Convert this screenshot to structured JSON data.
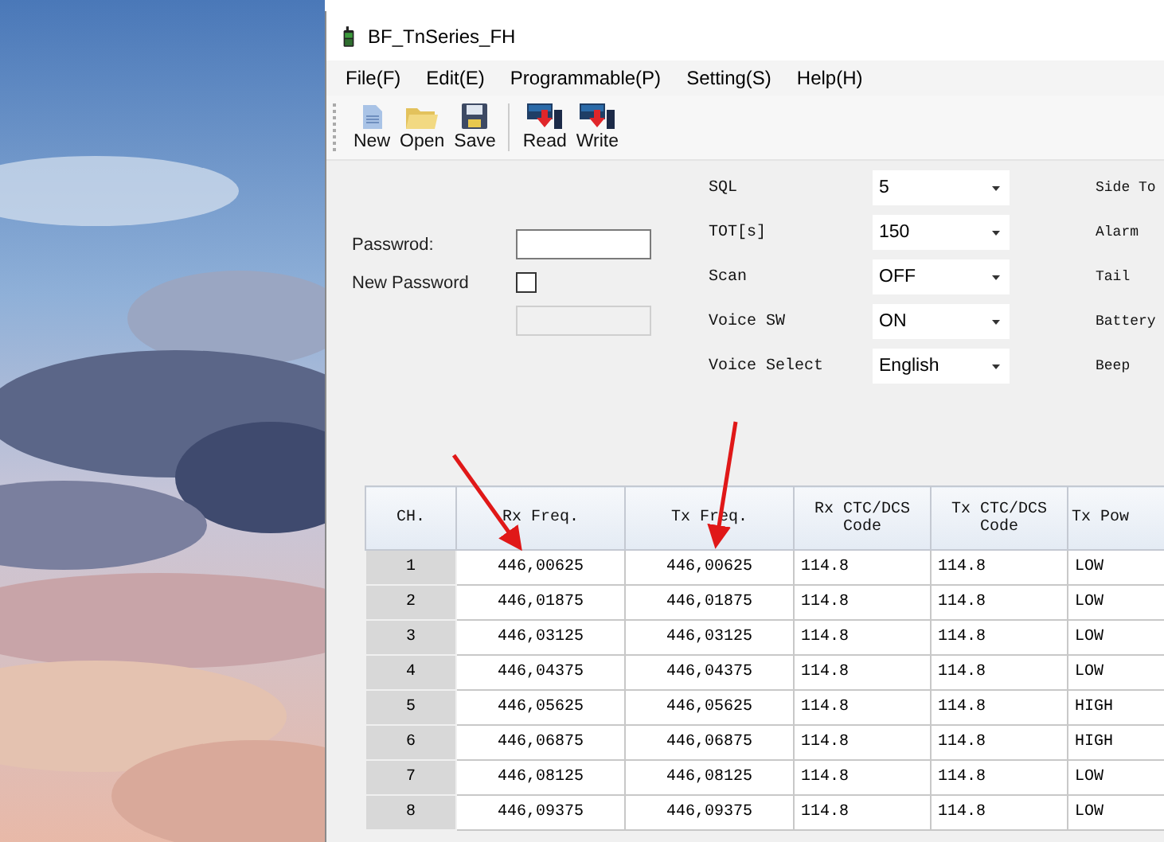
{
  "window": {
    "title": "BF_TnSeries_FH"
  },
  "menu": [
    "File(F)",
    "Edit(E)",
    "Programmable(P)",
    "Setting(S)",
    "Help(H)"
  ],
  "toolbar": [
    {
      "label": "New",
      "kind": "new"
    },
    {
      "label": "Open",
      "kind": "open"
    },
    {
      "label": "Save",
      "kind": "save"
    },
    {
      "label": "Read",
      "kind": "read"
    },
    {
      "label": "Write",
      "kind": "write"
    }
  ],
  "password": {
    "label": "Passwrod:"
  },
  "new_password": {
    "label": "New Password",
    "checked": false
  },
  "settings": [
    {
      "label": "SQL",
      "value": "5",
      "side_label": "Side To"
    },
    {
      "label": "TOT[s]",
      "value": "150",
      "side_label": "Alarm"
    },
    {
      "label": "Scan",
      "value": "OFF",
      "side_label": "Tail"
    },
    {
      "label": "Voice SW",
      "value": "ON",
      "side_label": "Battery"
    },
    {
      "label": "Voice Select",
      "value": "English",
      "side_label": "Beep"
    }
  ],
  "table": {
    "columns": [
      "CH.",
      "Rx Freq.",
      "Tx Freq.",
      "Rx CTC/DCS Code",
      "Tx CTC/DCS Code",
      "Tx Pow"
    ],
    "rows": [
      [
        "1",
        "446,00625",
        "446,00625",
        "114.8",
        "114.8",
        "LOW"
      ],
      [
        "2",
        "446,01875",
        "446,01875",
        "114.8",
        "114.8",
        "LOW"
      ],
      [
        "3",
        "446,03125",
        "446,03125",
        "114.8",
        "114.8",
        "LOW"
      ],
      [
        "4",
        "446,04375",
        "446,04375",
        "114.8",
        "114.8",
        "LOW"
      ],
      [
        "5",
        "446,05625",
        "446,05625",
        "114.8",
        "114.8",
        "HIGH"
      ],
      [
        "6",
        "446,06875",
        "446,06875",
        "114.8",
        "114.8",
        "HIGH"
      ],
      [
        "7",
        "446,08125",
        "446,08125",
        "114.8",
        "114.8",
        "LOW"
      ],
      [
        "8",
        "446,09375",
        "446,09375",
        "114.8",
        "114.8",
        "LOW"
      ]
    ]
  }
}
